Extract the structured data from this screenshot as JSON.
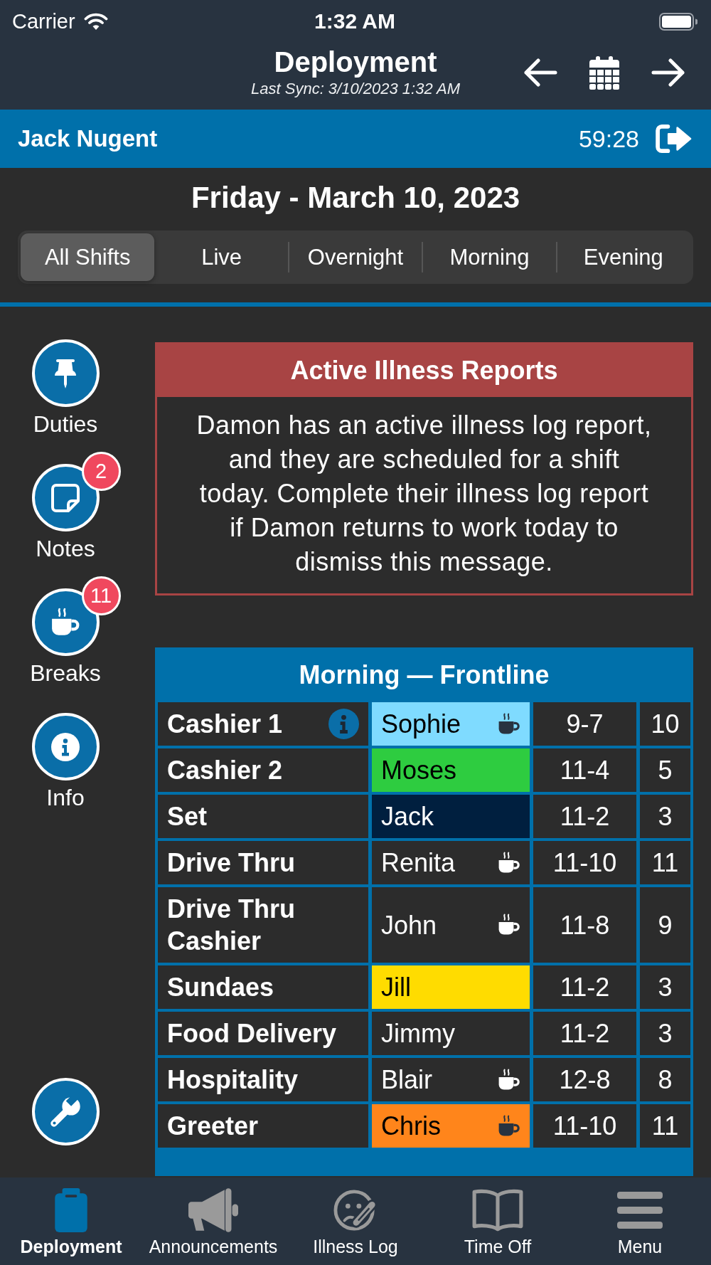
{
  "status_bar": {
    "carrier": "Carrier",
    "time": "1:32 AM"
  },
  "header": {
    "title": "Deployment",
    "subtitle": "Last Sync: 3/10/2023 1:32 AM"
  },
  "user_bar": {
    "name": "Jack Nugent",
    "timer": "59:28"
  },
  "date_title": "Friday - March 10, 2023",
  "shift_tabs": [
    {
      "label": "All Shifts",
      "selected": true
    },
    {
      "label": "Live",
      "selected": false
    },
    {
      "label": "Overnight",
      "selected": false
    },
    {
      "label": "Morning",
      "selected": false
    },
    {
      "label": "Evening",
      "selected": false
    }
  ],
  "sidebar": {
    "items": [
      {
        "kind": "pin",
        "label": "Duties"
      },
      {
        "kind": "note",
        "label": "Notes",
        "badge": "2"
      },
      {
        "kind": "cup",
        "label": "Breaks",
        "badge": "11"
      },
      {
        "kind": "info",
        "label": "Info"
      }
    ],
    "footer_items": [
      {
        "kind": "wrench"
      }
    ]
  },
  "illness_alert": {
    "title": "Active Illness Reports",
    "message": "Damon has an active illness log report, and they are scheduled for a shift today. Complete their illness log report if Damon returns to work today to dismiss this message."
  },
  "deployment_table": {
    "title": "Morning — Frontline",
    "rows": [
      {
        "position": "Cashier 1",
        "info": true,
        "employee": "Sophie",
        "color": "#7fdbff",
        "break": true,
        "column_3": "9-7",
        "column_4": "10"
      },
      {
        "position": "Cashier 2",
        "info": false,
        "employee": "Moses",
        "color": "#2ecc40",
        "break": false,
        "column_3": "11-4",
        "column_4": "5"
      },
      {
        "position": "Set",
        "info": false,
        "employee": "Jack",
        "color": "#001f3f",
        "break": false,
        "column_3": "11-2",
        "column_4": "3"
      },
      {
        "position": "Drive Thru",
        "info": false,
        "employee": "Renita",
        "break": true,
        "column_3": "11-10",
        "column_4": "11"
      },
      {
        "position": "Drive Thru Cashier",
        "info": false,
        "employee": "John",
        "break": true,
        "column_3": "11-8",
        "column_4": "9"
      },
      {
        "position": "Sundaes",
        "info": false,
        "employee": "Jill",
        "color": "#ffdc00",
        "break": false,
        "column_3": "11-2",
        "column_4": "3"
      },
      {
        "position": "Food Delivery",
        "info": false,
        "employee": "Jimmy",
        "break": false,
        "column_3": "11-2",
        "column_4": "3"
      },
      {
        "position": "Hospitality",
        "info": false,
        "employee": "Blair",
        "break": true,
        "column_3": "12-8",
        "column_4": "8"
      },
      {
        "position": "Greeter",
        "info": false,
        "employee": "Chris",
        "color": "#ff851b",
        "break": true,
        "column_3": "11-10",
        "column_4": "11"
      }
    ]
  },
  "tab_bar": {
    "items": [
      {
        "kind": "clipboard",
        "label": "Deployment",
        "selected": true
      },
      {
        "kind": "megaphone",
        "label": "Announcements",
        "selected": false
      },
      {
        "kind": "sick_face",
        "label": "Illness Log",
        "selected": false
      },
      {
        "kind": "book",
        "label": "Time Off",
        "selected": false
      },
      {
        "kind": "menu",
        "label": "Menu",
        "selected": false
      }
    ]
  }
}
